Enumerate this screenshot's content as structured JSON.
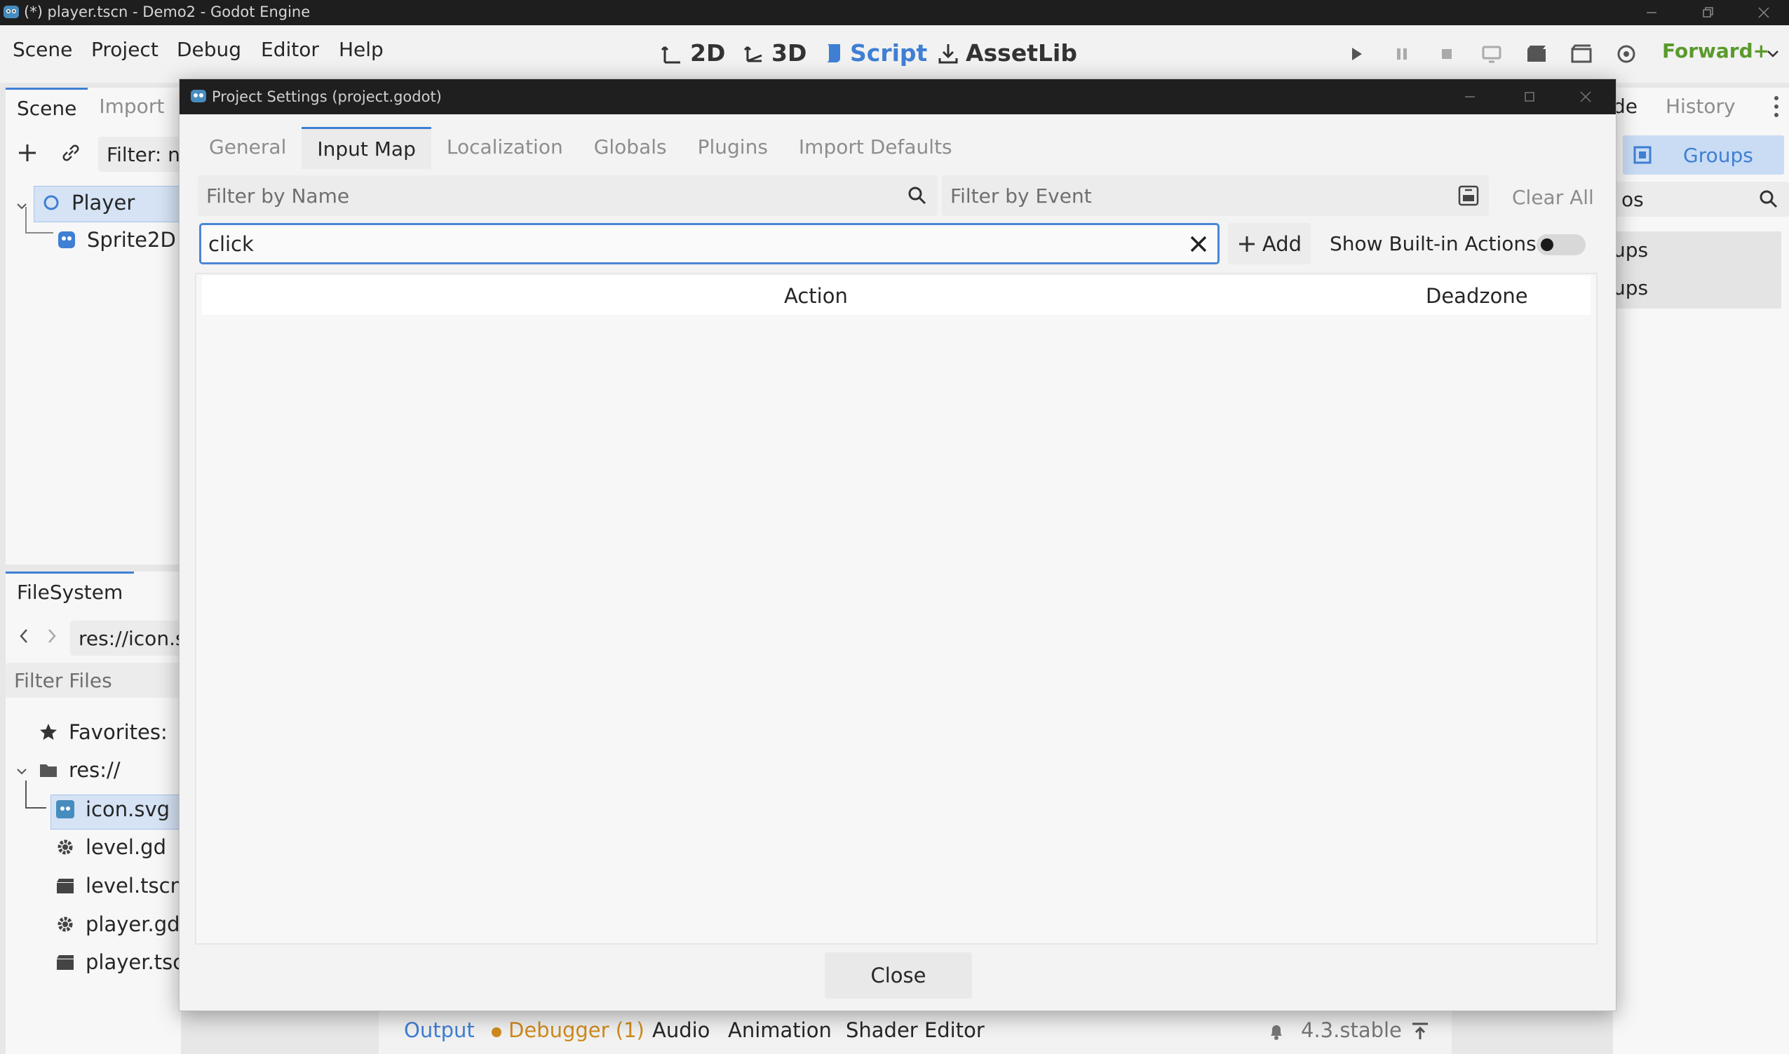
{
  "window": {
    "title": "(*) player.tscn - Demo2 - Godot Engine"
  },
  "menu": [
    "Scene",
    "Project",
    "Debug",
    "Editor",
    "Help"
  ],
  "workspaces": [
    {
      "label": "2D",
      "active": false
    },
    {
      "label": "3D",
      "active": false
    },
    {
      "label": "Script",
      "active": true
    },
    {
      "label": "AssetLib",
      "active": false
    }
  ],
  "renderer": "Forward+",
  "scene_dock": {
    "tabs": [
      "Scene",
      "Import"
    ],
    "filter_placeholder": "Filter: n",
    "nodes": [
      {
        "label": "Player",
        "icon": "node2d-icon"
      },
      {
        "label": "Sprite2D",
        "icon": "sprite2d-icon"
      }
    ]
  },
  "right_dock": {
    "tabs": [
      "de",
      "History"
    ],
    "groups_label": "Groups",
    "filter_fragment": "os",
    "items": [
      "ups",
      "ups"
    ]
  },
  "filesystem_dock": {
    "tab": "FileSystem",
    "path": "res://icon.sv",
    "filter_placeholder": "Filter Files",
    "favorites": "Favorites:",
    "root": "res://",
    "files": [
      {
        "label": "icon.svg",
        "icon": "godot-icon"
      },
      {
        "label": "level.gd",
        "icon": "gear-icon"
      },
      {
        "label": "level.tscn",
        "icon": "clapper-icon"
      },
      {
        "label": "player.gd",
        "icon": "gear-icon"
      },
      {
        "label": "player.tscr",
        "icon": "clapper-icon"
      }
    ]
  },
  "dialog": {
    "title": "Project Settings (project.godot)",
    "tabs": [
      "General",
      "Input Map",
      "Localization",
      "Globals",
      "Plugins",
      "Import Defaults"
    ],
    "active_tab": "Input Map",
    "filter_name_placeholder": "Filter by Name",
    "filter_event_placeholder": "Filter by Event",
    "clear_all": "Clear All",
    "action_input_value": "click",
    "add_label": "Add",
    "show_builtin_label": "Show Built-in Actions",
    "show_builtin_on": false,
    "columns": [
      "Action",
      "Deadzone"
    ],
    "close_label": "Close"
  },
  "bottom_panel": {
    "tabs": [
      "Output",
      "Debugger (1)",
      "Audio",
      "Animation",
      "Shader Editor"
    ],
    "version": "4.3.stable"
  },
  "colors": {
    "accent": "#3f7fd4",
    "renderer": "#5a9a2c",
    "debugger": "#d08a1c"
  }
}
